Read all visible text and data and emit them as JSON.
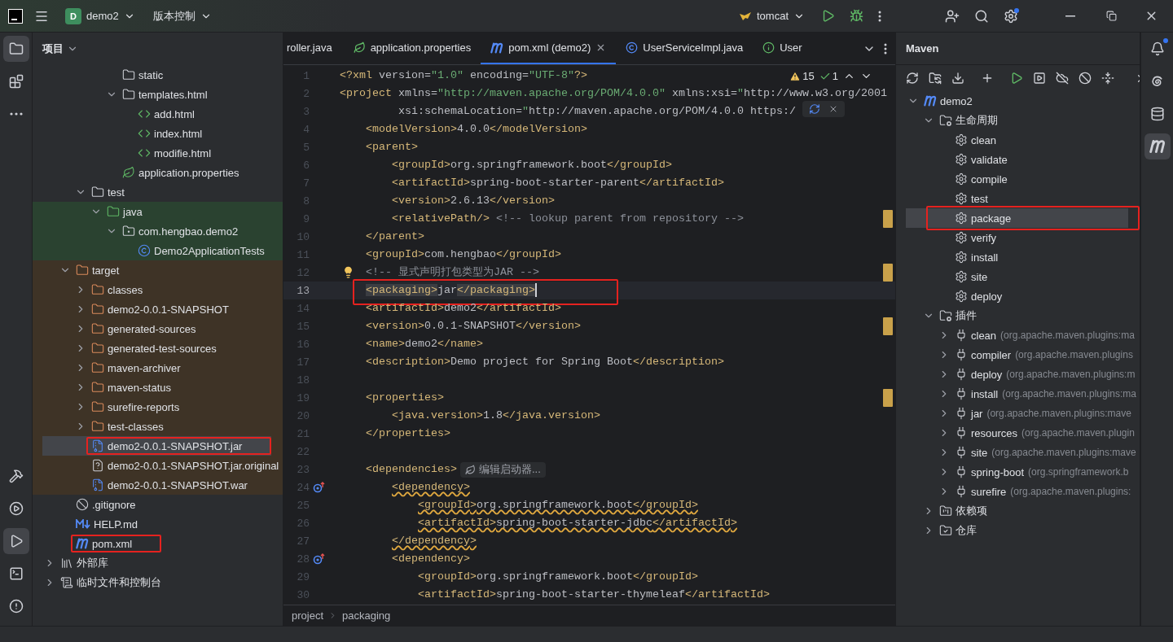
{
  "titlebar": {
    "project": {
      "initial": "D",
      "name": "demo2"
    },
    "vcs": "版本控制",
    "run_config": "tomcat",
    "settings_badge": true
  },
  "left_tools": [
    {
      "kind": "project",
      "selected": true
    },
    {
      "kind": "structure",
      "selected": false
    },
    {
      "kind": "more",
      "selected": false
    },
    {
      "kind": "build",
      "selected": false
    },
    {
      "kind": "services",
      "selected": false
    },
    {
      "kind": "run",
      "selected": true
    },
    {
      "kind": "terminal",
      "selected": false
    },
    {
      "kind": "problems",
      "selected": false
    }
  ],
  "project": {
    "title": "项目",
    "tree": [
      {
        "children": [
          {
            "children": [
              {
                "children": [
                  {
                    "children": [
                      {
                        "label": "static",
                        "kind": "folder",
                        "selected": false
                      },
                      {
                        "label": "templates.html",
                        "kind": "folder",
                        "expanded": true,
                        "selected": false,
                        "children": [
                          {
                            "label": "add.html",
                            "kind": "html",
                            "selected": false
                          },
                          {
                            "label": "index.html",
                            "kind": "html",
                            "selected": false
                          },
                          {
                            "label": "modifie.html",
                            "kind": "html",
                            "selected": false
                          }
                        ]
                      },
                      {
                        "label": "application.properties",
                        "kind": "properties",
                        "selected": false
                      }
                    ]
                  }
                ]
              },
              {
                "label": "test",
                "kind": "folder",
                "expanded": true,
                "selected": false,
                "children": [
                  {
                    "label": "java",
                    "kind": "test-root",
                    "expanded": true,
                    "test_source": true,
                    "selected": false,
                    "children": [
                      {
                        "label": "com.hengbao.demo2",
                        "kind": "package",
                        "expanded": true,
                        "test_source": true,
                        "selected": false,
                        "children": [
                          {
                            "label": "Demo2ApplicationTests",
                            "kind": "test-class",
                            "test_source": true,
                            "selected": false
                          }
                        ]
                      }
                    ]
                  }
                ]
              }
            ]
          },
          {
            "label": "target",
            "kind": "excluded-folder",
            "expanded": true,
            "excluded": true,
            "selected": false,
            "children": [
              {
                "label": "classes",
                "kind": "excluded-folder",
                "expanded": false,
                "excluded": true,
                "selected": false
              },
              {
                "label": "demo2-0.0.1-SNAPSHOT",
                "kind": "excluded-folder",
                "expanded": false,
                "excluded": true,
                "selected": false
              },
              {
                "label": "generated-sources",
                "kind": "excluded-folder",
                "expanded": false,
                "excluded": true,
                "selected": false
              },
              {
                "label": "generated-test-sources",
                "kind": "excluded-folder",
                "expanded": false,
                "excluded": true,
                "selected": false
              },
              {
                "label": "maven-archiver",
                "kind": "excluded-folder",
                "expanded": false,
                "excluded": true,
                "selected": false
              },
              {
                "label": "maven-status",
                "kind": "excluded-folder",
                "expanded": false,
                "excluded": true,
                "selected": false
              },
              {
                "label": "surefire-reports",
                "kind": "excluded-folder",
                "expanded": false,
                "excluded": true,
                "selected": false
              },
              {
                "label": "test-classes",
                "kind": "excluded-folder",
                "expanded": false,
                "excluded": true,
                "selected": false
              },
              {
                "label": "demo2-0.0.1-SNAPSHOT.jar",
                "kind": "archive",
                "excluded": true,
                "selected": true,
                "boxed": true
              },
              {
                "label": "demo2-0.0.1-SNAPSHOT.jar.original",
                "kind": "unknown",
                "excluded": true,
                "selected": false
              },
              {
                "label": "demo2-0.0.1-SNAPSHOT.war",
                "kind": "archive",
                "excluded": true,
                "selected": false
              }
            ]
          },
          {
            "label": ".gitignore",
            "kind": "ignore",
            "selected": false
          },
          {
            "label": "HELP.md",
            "kind": "markdown",
            "selected": false
          },
          {
            "label": "pom.xml",
            "kind": "maven",
            "selected": false,
            "boxed": true
          }
        ]
      },
      {
        "label": "外部库",
        "kind": "library",
        "expanded": false,
        "selected": false
      },
      {
        "label": "临时文件和控制台",
        "kind": "scratch",
        "expanded": false,
        "selected": false
      }
    ]
  },
  "editor": {
    "tabs": [
      {
        "label": "roller.java",
        "kind": "none",
        "selected": false
      },
      {
        "label": "application.properties",
        "kind": "properties",
        "selected": false
      },
      {
        "label": "pom.xml (demo2)",
        "kind": "maven",
        "selected": true,
        "closable": true
      },
      {
        "label": "UserServiceImpl.java",
        "kind": "class",
        "selected": false
      },
      {
        "label": "User",
        "kind": "info",
        "selected": false
      }
    ],
    "inspections": {
      "warnings": "15",
      "weak_warnings": "1"
    },
    "lines": [
      {
        "number": "1",
        "text": "<?xml version=\"1.0\" encoding=\"UTF-8\"?>",
        "current": false,
        "warning": false
      },
      {
        "number": "2",
        "text": "<project xmlns=\"http://maven.apache.org/POM/4.0.0\" xmlns:xsi=\"http://www.w3.org/2001",
        "current": false,
        "warning": false
      },
      {
        "number": "3",
        "text": "         xsi:schemaLocation=\"http://maven.apache.org/POM/4.0.0 https:/",
        "current": false,
        "warning": false
      },
      {
        "number": "4",
        "text": "    <modelVersion>4.0.0</modelVersion>",
        "current": false,
        "warning": false
      },
      {
        "number": "5",
        "text": "    <parent>",
        "current": false,
        "warning": false
      },
      {
        "number": "6",
        "text": "        <groupId>org.springframework.boot</groupId>",
        "current": false,
        "warning": false
      },
      {
        "number": "7",
        "text": "        <artifactId>spring-boot-starter-parent</artifactId>",
        "current": false,
        "warning": false
      },
      {
        "number": "8",
        "text": "        <version>2.6.13</version>",
        "current": false,
        "warning": false
      },
      {
        "number": "9",
        "text": "        <relativePath/> <!-- lookup parent from repository -->",
        "current": false,
        "warning": false,
        "marker": true
      },
      {
        "number": "10",
        "text": "    </parent>",
        "current": false,
        "warning": false
      },
      {
        "number": "11",
        "text": "    <groupId>com.hengbao</groupId>",
        "current": false,
        "warning": false
      },
      {
        "number": "12",
        "text": "    <!-- 显式声明打包类型为JAR -->",
        "current": false,
        "warning": false,
        "marker": true,
        "bulb": true
      },
      {
        "number": "13",
        "text": "    <packaging>jar</packaging>",
        "current": true,
        "warning": false,
        "boxed": true
      },
      {
        "number": "14",
        "text": "    <artifactId>demo2</artifactId>",
        "current": false,
        "warning": false
      },
      {
        "number": "15",
        "text": "    <version>0.0.1-SNAPSHOT</version>",
        "current": false,
        "warning": false,
        "marker": true
      },
      {
        "number": "16",
        "text": "    <name>demo2</name>",
        "current": false,
        "warning": false
      },
      {
        "number": "17",
        "text": "    <description>Demo project for Spring Boot</description>",
        "current": false,
        "warning": false
      },
      {
        "number": "18",
        "current": false
      },
      {
        "number": "19",
        "text": "    <properties>",
        "current": false,
        "warning": false,
        "marker": true
      },
      {
        "number": "20",
        "text": "        <java.version>1.8</java.version>",
        "current": false,
        "warning": false
      },
      {
        "number": "21",
        "text": "    </properties>",
        "current": false,
        "warning": false
      },
      {
        "number": "22",
        "current": false
      },
      {
        "number": "23",
        "text": "    <dependencies>",
        "inlay": "编辑启动器...",
        "current": false,
        "warning": false
      },
      {
        "number": "24",
        "text": "        <dependency>",
        "current": false,
        "warning": true,
        "gutter_icon": true
      },
      {
        "number": "25",
        "text": "            <groupId>org.springframework.boot</groupId>",
        "current": false,
        "warning": true
      },
      {
        "number": "26",
        "text": "            <artifactId>spring-boot-starter-jdbc</artifactId>",
        "current": false,
        "warning": true
      },
      {
        "number": "27",
        "text": "        </dependency>",
        "current": false,
        "warning": true
      },
      {
        "number": "28",
        "text": "        <dependency>",
        "current": false,
        "warning": false,
        "gutter_icon": true
      },
      {
        "number": "29",
        "text": "            <groupId>org.springframework.boot</groupId>",
        "current": false,
        "warning": false
      },
      {
        "number": "30",
        "text": "            <artifactId>spring-boot-starter-thymeleaf</artifactId>",
        "current": false,
        "warning": false
      }
    ],
    "breadcrumbs": [
      "project",
      "packaging"
    ]
  },
  "maven": {
    "title": "Maven",
    "tree": [
      {
        "label": "demo2",
        "kind": "project",
        "expanded": true,
        "selected": false,
        "children": [
          {
            "label": "生命周期",
            "kind": "lifecycle",
            "expanded": true,
            "selected": false,
            "children": [
              {
                "label": "clean",
                "kind": "goal",
                "selected": false
              },
              {
                "label": "validate",
                "kind": "goal",
                "selected": false
              },
              {
                "label": "compile",
                "kind": "goal",
                "selected": false
              },
              {
                "label": "test",
                "kind": "goal",
                "selected": false
              },
              {
                "label": "package",
                "kind": "goal",
                "selected": true,
                "boxed": true
              },
              {
                "label": "verify",
                "kind": "goal",
                "selected": false
              },
              {
                "label": "install",
                "kind": "goal",
                "selected": false
              },
              {
                "label": "site",
                "kind": "goal",
                "selected": false
              },
              {
                "label": "deploy",
                "kind": "goal",
                "selected": false
              }
            ]
          },
          {
            "label": "插件",
            "kind": "plugins",
            "expanded": true,
            "selected": false,
            "children": [
              {
                "label": "clean",
                "detail": "(org.apache.maven.plugins:ma",
                "kind": "plugin",
                "expanded": false,
                "selected": false
              },
              {
                "label": "compiler",
                "detail": "(org.apache.maven.plugins",
                "kind": "plugin",
                "expanded": false,
                "selected": false
              },
              {
                "label": "deploy",
                "detail": "(org.apache.maven.plugins:m",
                "kind": "plugin",
                "expanded": false,
                "selected": false
              },
              {
                "label": "install",
                "detail": "(org.apache.maven.plugins:ma",
                "kind": "plugin",
                "expanded": false,
                "selected": false
              },
              {
                "label": "jar",
                "detail": "(org.apache.maven.plugins:mave",
                "kind": "plugin",
                "expanded": false,
                "selected": false
              },
              {
                "label": "resources",
                "detail": "(org.apache.maven.plugin",
                "kind": "plugin",
                "expanded": false,
                "selected": false
              },
              {
                "label": "site",
                "detail": "(org.apache.maven.plugins:mave",
                "kind": "plugin",
                "expanded": false,
                "selected": false
              },
              {
                "label": "spring-boot",
                "detail": "(org.springframework.b",
                "kind": "plugin",
                "expanded": false,
                "selected": false
              },
              {
                "label": "surefire",
                "detail": "(org.apache.maven.plugins:",
                "kind": "plugin",
                "expanded": false,
                "selected": false
              }
            ]
          },
          {
            "label": "依赖项",
            "kind": "dependencies",
            "expanded": false,
            "selected": false
          },
          {
            "label": "仓库",
            "kind": "repositories",
            "expanded": false,
            "selected": false
          }
        ]
      }
    ]
  },
  "right_tools": [
    {
      "kind": "notifications",
      "selected": false,
      "badge": true
    },
    {
      "kind": "ai",
      "selected": false
    },
    {
      "kind": "database",
      "selected": false
    },
    {
      "kind": "maven",
      "selected": true
    }
  ]
}
